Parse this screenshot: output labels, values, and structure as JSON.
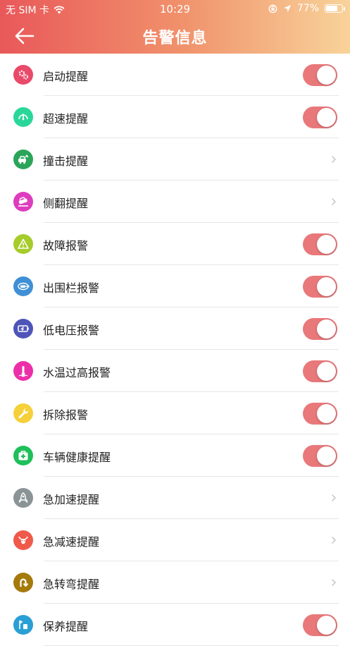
{
  "status": {
    "carrier": "无 SIM 卡",
    "time": "10:29",
    "battery": "77%",
    "battery_level": 0.77
  },
  "nav": {
    "title": "告警信息",
    "back_icon": "arrow-left-icon"
  },
  "colors": {
    "toggle_on": "#e9787a",
    "header_start": "#e9585a",
    "header_end": "#f8d39a"
  },
  "items": [
    {
      "label": "启动提醒",
      "control": "toggle",
      "on": true,
      "icon": "gears-icon",
      "color": "#e94a6a"
    },
    {
      "label": "超速提醒",
      "control": "toggle",
      "on": true,
      "icon": "speedometer-icon",
      "color": "#2ad79a"
    },
    {
      "label": "撞击提醒",
      "control": "chevron",
      "icon": "car-crash-icon",
      "color": "#2aa55a"
    },
    {
      "label": "侧翻提醒",
      "control": "chevron",
      "icon": "car-rollover-icon",
      "color": "#de3cbf"
    },
    {
      "label": "故障报警",
      "control": "toggle",
      "on": true,
      "icon": "warning-triangle-icon",
      "color": "#a5cc2a"
    },
    {
      "label": "出围栏报警",
      "control": "toggle",
      "on": true,
      "icon": "fence-exit-icon",
      "color": "#3f8fd6"
    },
    {
      "label": "低电压报警",
      "control": "toggle",
      "on": true,
      "icon": "battery-low-icon",
      "color": "#4f55b8"
    },
    {
      "label": "水温过高报警",
      "control": "toggle",
      "on": true,
      "icon": "thermometer-icon",
      "color": "#ec2fa8"
    },
    {
      "label": "拆除报警",
      "control": "toggle",
      "on": true,
      "icon": "wrench-icon",
      "color": "#f6d03a"
    },
    {
      "label": "车辆健康提醒",
      "control": "toggle",
      "on": true,
      "icon": "first-aid-icon",
      "color": "#1fbf5a"
    },
    {
      "label": "急加速提醒",
      "control": "chevron",
      "icon": "rocket-icon",
      "color": "#8a9497"
    },
    {
      "label": "急减速提醒",
      "control": "chevron",
      "icon": "bull-icon",
      "color": "#ef5a4a"
    },
    {
      "label": "急转弯提醒",
      "control": "chevron",
      "icon": "u-turn-icon",
      "color": "#a57a0a"
    },
    {
      "label": "保养提醒",
      "control": "toggle",
      "on": true,
      "icon": "maintenance-icon",
      "color": "#2a9fd6"
    }
  ]
}
